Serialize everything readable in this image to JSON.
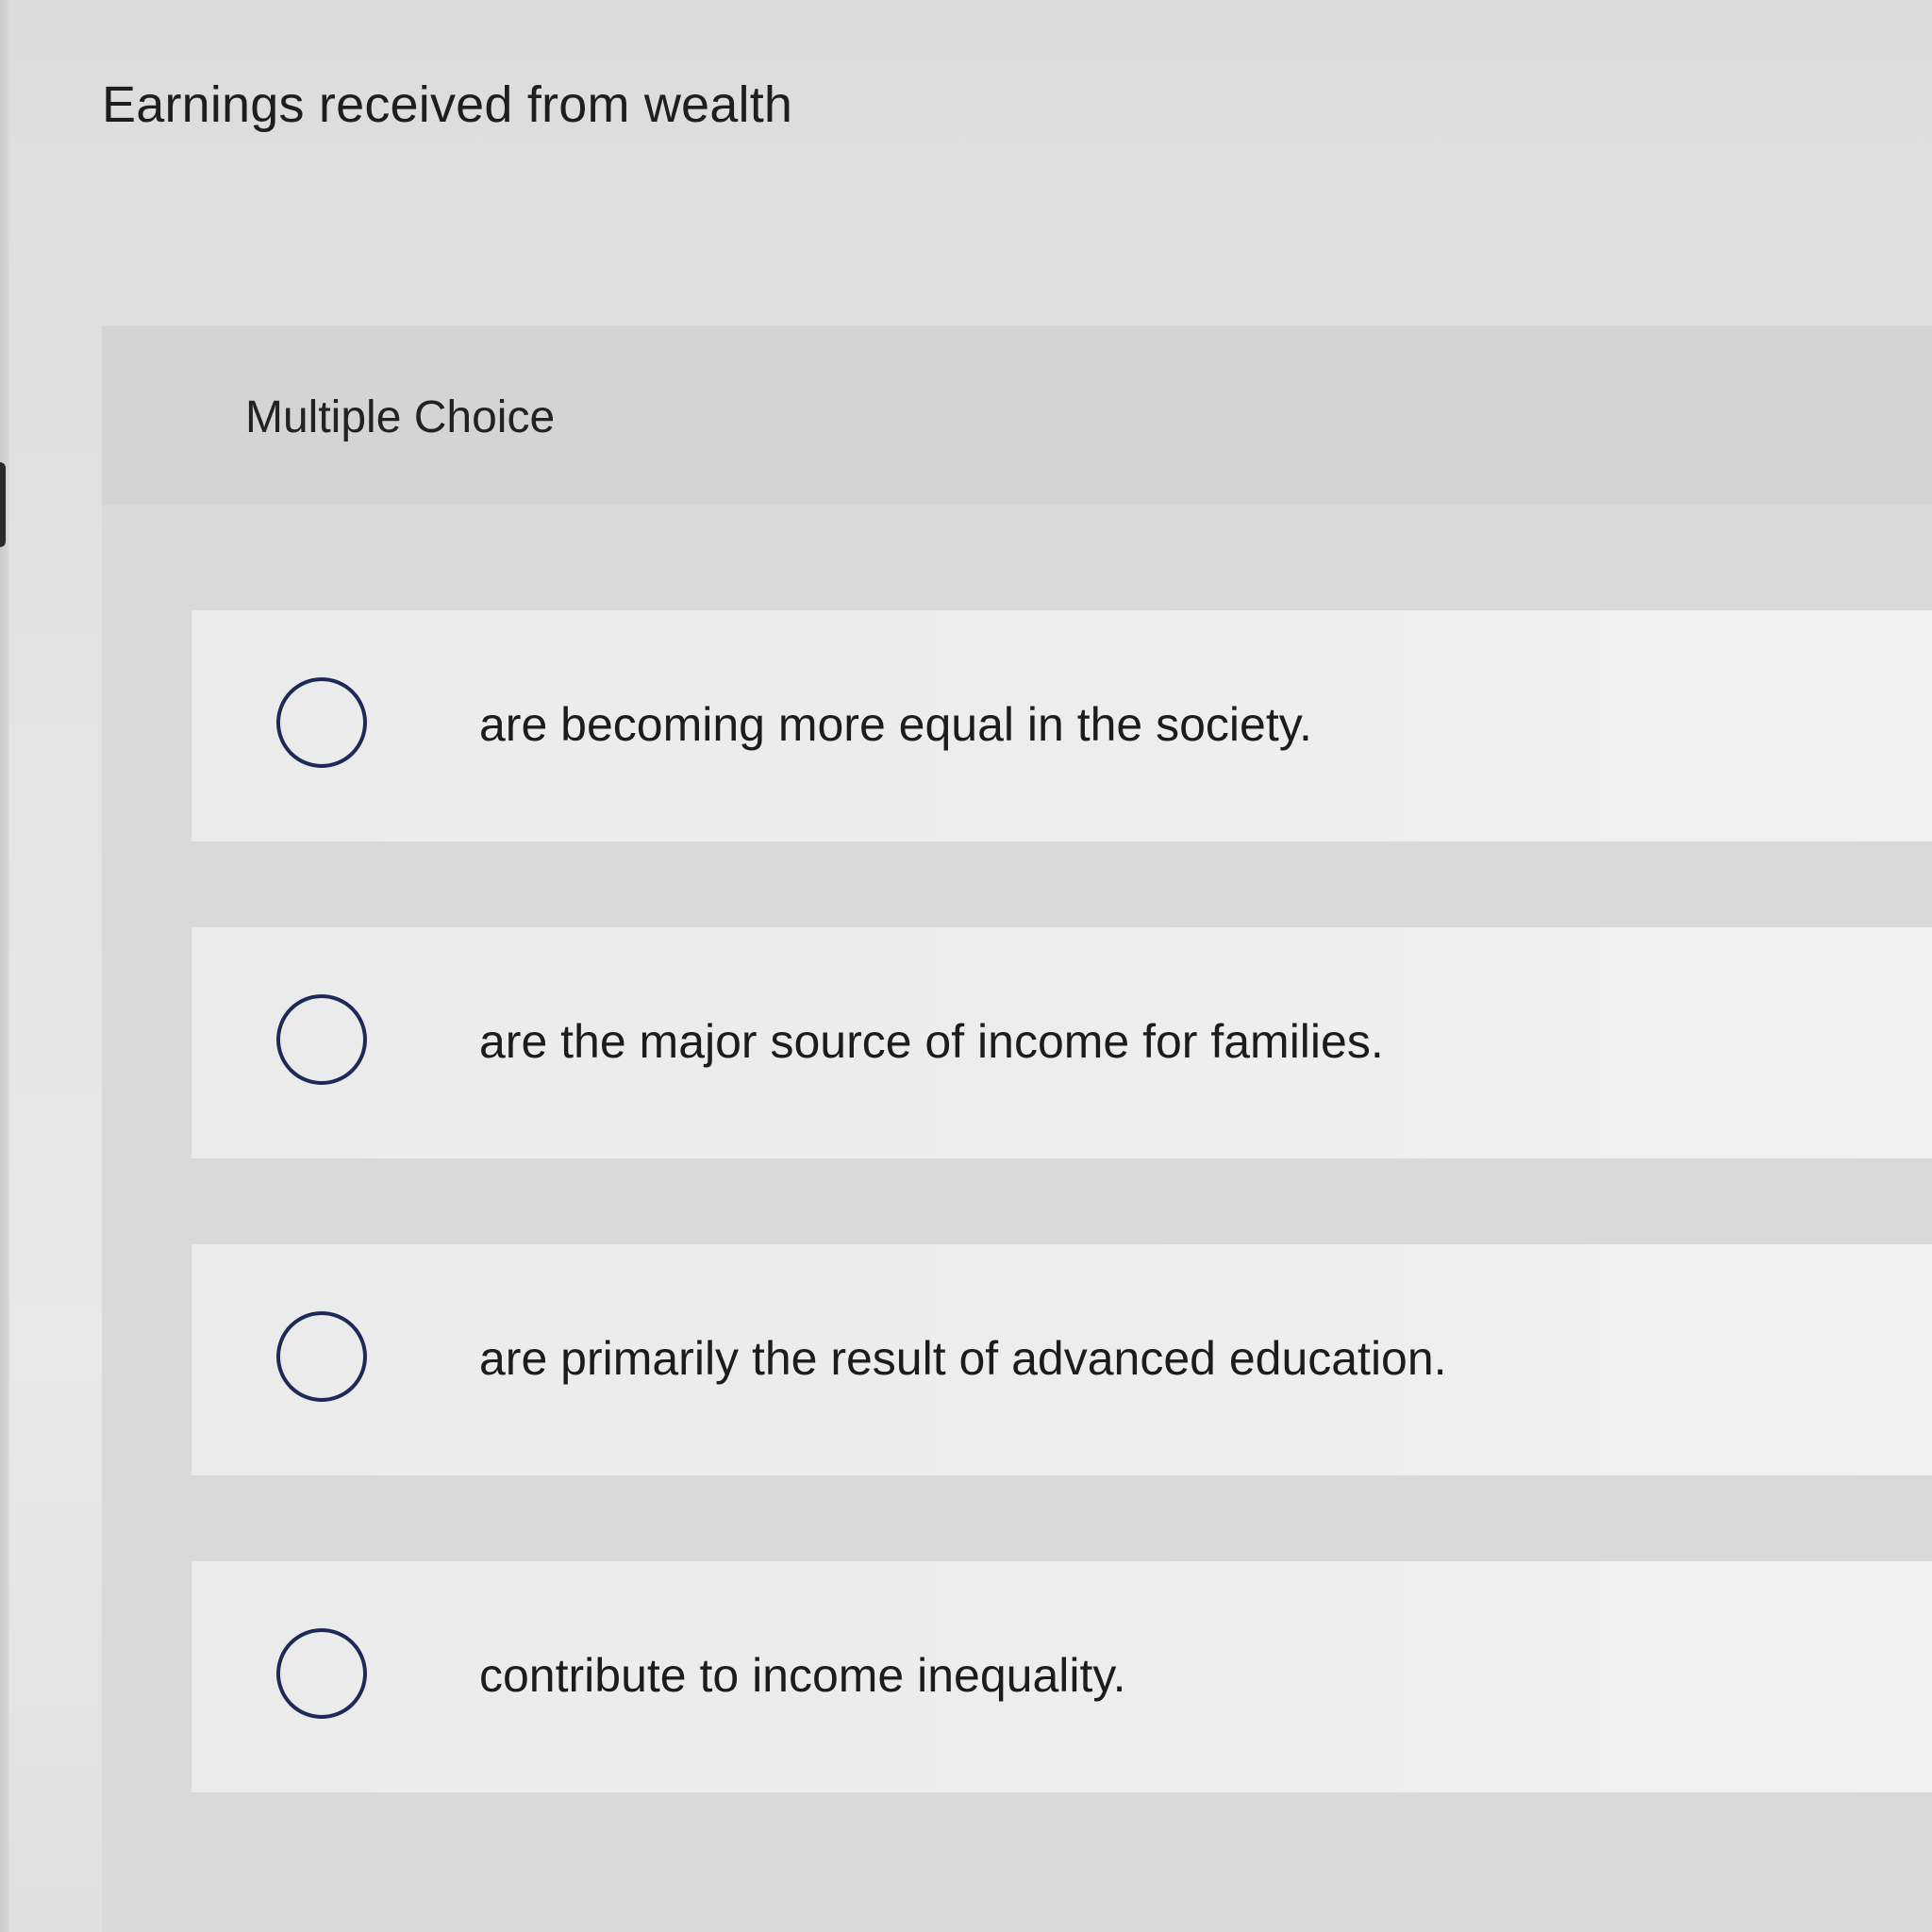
{
  "question": {
    "prompt": "Earnings received from wealth"
  },
  "panel": {
    "header_label": "Multiple Choice"
  },
  "choices": [
    {
      "text": "are becoming more equal in the society.",
      "selected": false
    },
    {
      "text": "are the major source of income for families.",
      "selected": false
    },
    {
      "text": "are primarily the result of advanced education.",
      "selected": false
    },
    {
      "text": "contribute to income inequality.",
      "selected": false
    }
  ],
  "colors": {
    "radio_border": "#1d2a57",
    "panel_bg": "#d9d9d9",
    "choice_bg": "#ededed",
    "text": "#1c1c1c"
  }
}
